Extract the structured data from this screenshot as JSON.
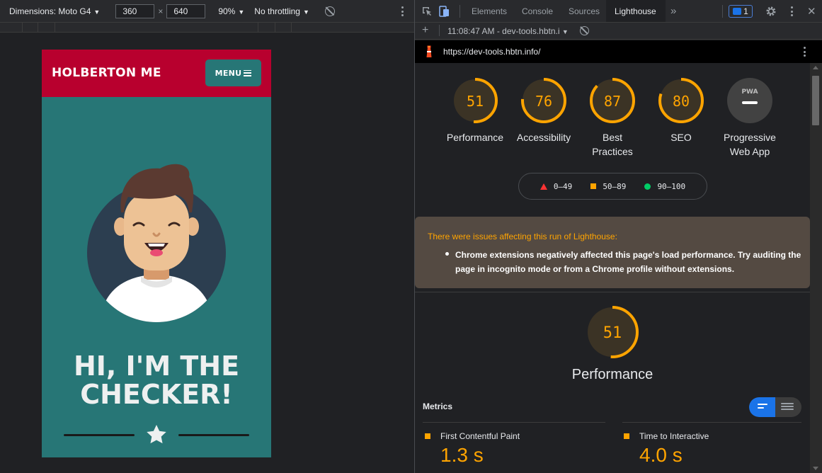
{
  "device_toolbar": {
    "dimensions_label": "Dimensions: Moto G4",
    "width_value": "360",
    "times": "×",
    "height_value": "640",
    "zoom": "90%",
    "throttling": "No throttling",
    "dropdown_caret": "▼"
  },
  "site": {
    "logo": "HOLBERTON ME",
    "menu_label": "MENU",
    "hero_line1": "HI, I'M THE",
    "hero_line2": "CHECKER!",
    "colors": {
      "header": "#b8002e",
      "body": "#277676"
    }
  },
  "devtools": {
    "tabs": [
      "Elements",
      "Console",
      "Sources",
      "Lighthouse"
    ],
    "active_tab": "Lighthouse",
    "overflow_glyph": "»",
    "issues_count": "1",
    "report_selector": "11:08:47 AM - dev-tools.hbtn.i",
    "report_caret": "▼",
    "add_glyph": "+",
    "close_glyph": "✕",
    "url": "https://dev-tools.hbtn.info/"
  },
  "lighthouse": {
    "categories": [
      {
        "score": "51",
        "label_line1": "Performance",
        "label_line2": "",
        "fraction": 0.51,
        "color": "#ffa400"
      },
      {
        "score": "76",
        "label_line1": "Accessibility",
        "label_line2": "",
        "fraction": 0.76,
        "color": "#ffa400"
      },
      {
        "score": "87",
        "label_line1": "Best",
        "label_line2": "Practices",
        "fraction": 0.87,
        "color": "#ffa400"
      },
      {
        "score": "80",
        "label_line1": "SEO",
        "label_line2": "",
        "fraction": 0.8,
        "color": "#ffa400"
      }
    ],
    "pwa": {
      "badge": "PWA",
      "label_line1": "Progressive",
      "label_line2": "Web App"
    },
    "legend": [
      {
        "range": "0–49",
        "color": "#ff3333"
      },
      {
        "range": "50–89",
        "color": "#ffa400"
      },
      {
        "range": "90–100",
        "color": "#00cc66"
      }
    ],
    "warning": {
      "heading": "There were issues affecting this run of Lighthouse:",
      "item": "Chrome extensions negatively affected this page's load performance. Try auditing the page in incognito mode or from a Chrome profile without extensions."
    },
    "performance": {
      "score": "51",
      "fraction": 0.51,
      "title": "Performance"
    },
    "metrics_title": "Metrics",
    "metrics": [
      {
        "label": "First Contentful Paint",
        "value": "1.3 s"
      },
      {
        "label": "Time to Interactive",
        "value": "4.0 s"
      }
    ]
  }
}
